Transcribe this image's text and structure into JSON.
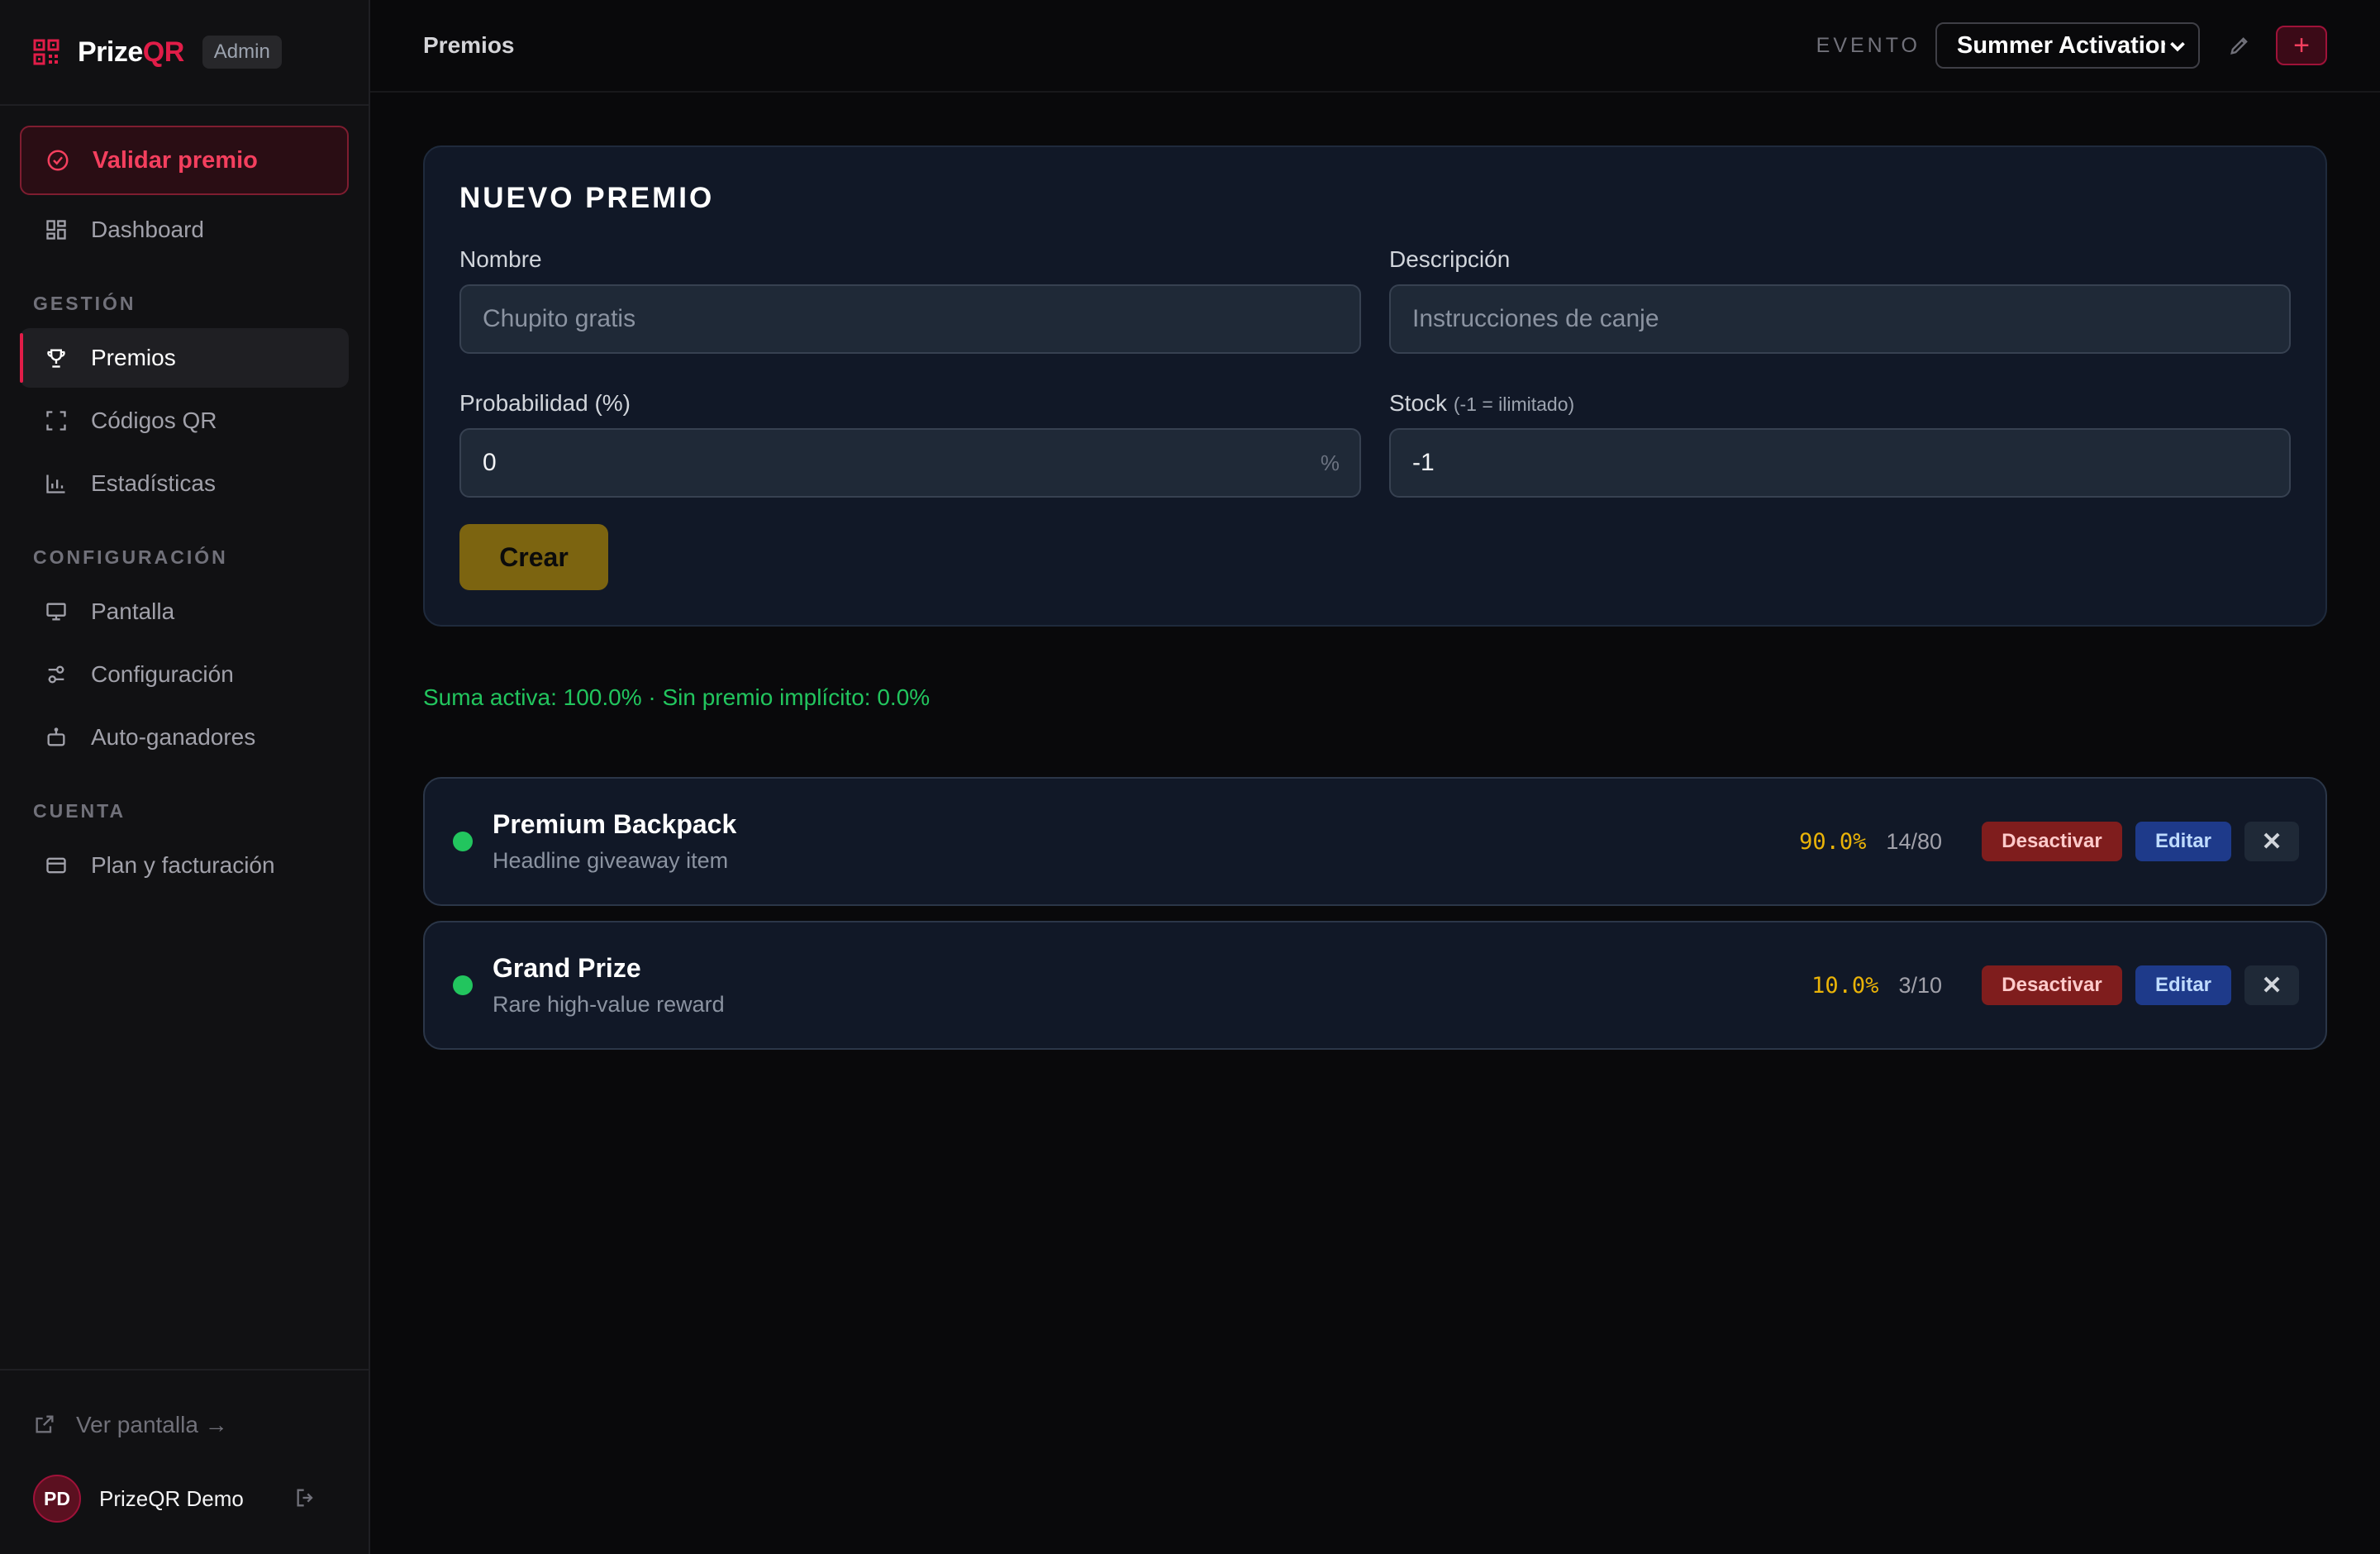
{
  "brand": {
    "name_prefix": "Prize",
    "name_suffix": "QR",
    "badge": "Admin"
  },
  "sidebar": {
    "validate_label": "Validar premio",
    "dashboard_label": "Dashboard",
    "sections": {
      "gestion": "GESTIÓN",
      "configuracion": "CONFIGURACIÓN",
      "cuenta": "CUENTA"
    },
    "gestion_items": [
      "Premios",
      "Códigos QR",
      "Estadísticas"
    ],
    "config_items": [
      "Pantalla",
      "Configuración",
      "Auto-ganadores"
    ],
    "cuenta_items": [
      "Plan y facturación"
    ],
    "ver_pantalla": "Ver pantalla →",
    "user": {
      "initials": "PD",
      "name": "PrizeQR Demo"
    }
  },
  "topbar": {
    "title": "Premios",
    "evento_label": "EVENTO",
    "event_selected": "Summer Activation",
    "add_label": "+"
  },
  "form": {
    "title": "NUEVO PREMIO",
    "nombre_label": "Nombre",
    "nombre_placeholder": "Chupito gratis",
    "descripcion_label": "Descripción",
    "descripcion_placeholder": "Instrucciones de canje",
    "probabilidad_label": "Probabilidad (%)",
    "probabilidad_value": "0",
    "probabilidad_suffix": "%",
    "stock_label": "Stock",
    "stock_hint": "(-1 = ilimitado)",
    "stock_value": "-1",
    "crear_label": "Crear"
  },
  "summary": "Suma activa: 100.0% · Sin premio implícito: 0.0%",
  "prizes": [
    {
      "name": "Premium Backpack",
      "description": "Headline giveaway item",
      "probability": "90.0%",
      "stock": "14/80",
      "deactivate": "Desactivar",
      "edit": "Editar",
      "delete": "✕"
    },
    {
      "name": "Grand Prize",
      "description": "Rare high-value reward",
      "probability": "10.0%",
      "stock": "3/10",
      "deactivate": "Desactivar",
      "edit": "Editar",
      "delete": "✕"
    }
  ],
  "colors": {
    "accent": "#e11d48",
    "success": "#22c55e",
    "probability": "#eab308"
  }
}
